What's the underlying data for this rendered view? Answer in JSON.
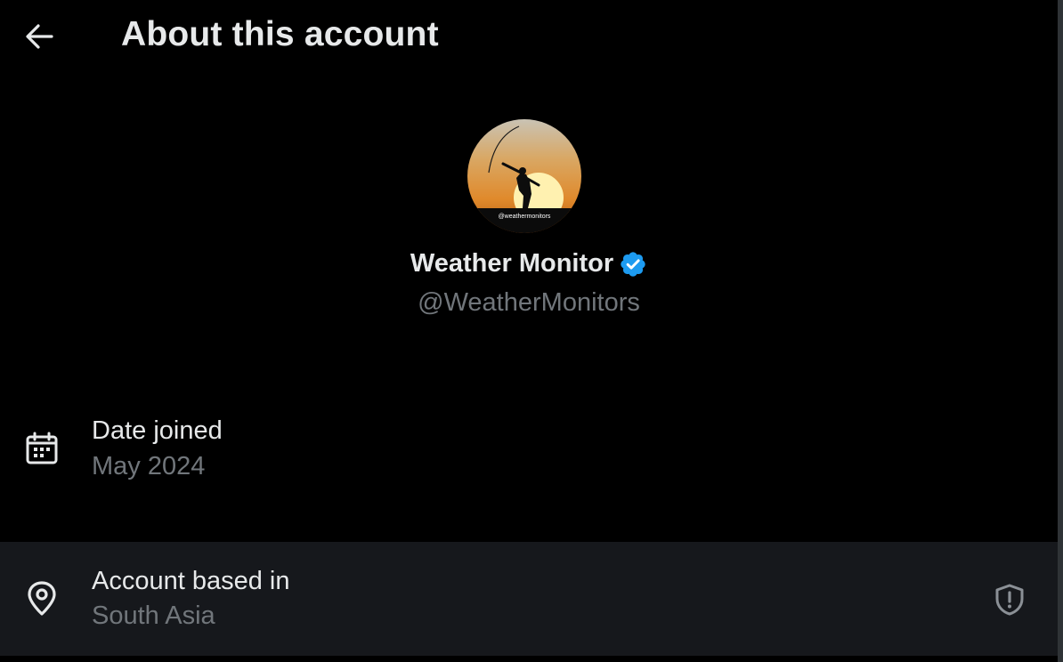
{
  "header": {
    "title": "About this account",
    "back_icon": "arrow-left-icon"
  },
  "profile": {
    "avatar_watermark": "@weathermonitors",
    "display_name": "Weather Monitor",
    "verified": true,
    "verified_color": "#1d9bf0",
    "handle": "@WeatherMonitors"
  },
  "details": {
    "date_joined": {
      "icon": "calendar-icon",
      "label": "Date joined",
      "value": "May 2024"
    },
    "account_based_in": {
      "icon": "location-pin-icon",
      "label": "Account based in",
      "value": "South Asia",
      "info_icon": "shield-alert-icon"
    }
  },
  "colors": {
    "background": "#000000",
    "primary_text": "#e7e9ea",
    "secondary_text": "#71767b",
    "highlight_row": "#16181c"
  }
}
